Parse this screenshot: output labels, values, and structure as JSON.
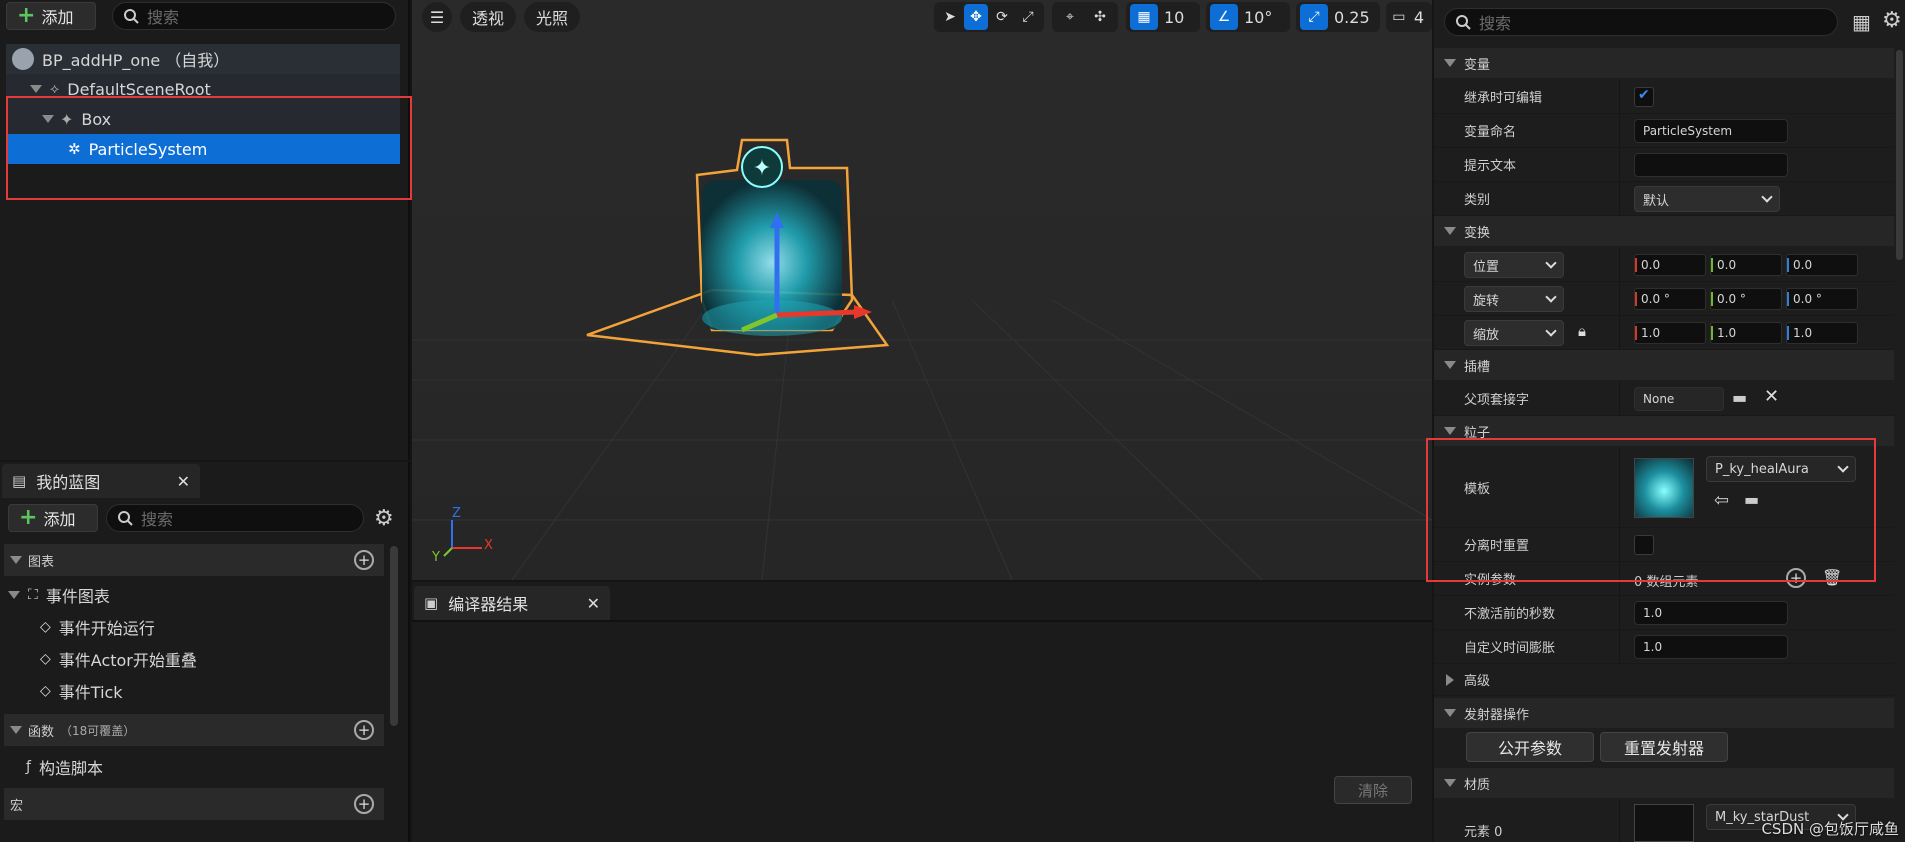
{
  "components": {
    "add_label": "添加",
    "search_placeholder": "搜索",
    "tree": [
      {
        "label": "BP_addHP_one （自我）"
      },
      {
        "label": "DefaultSceneRoot"
      },
      {
        "label": "Box"
      },
      {
        "label": "ParticleSystem"
      }
    ]
  },
  "my_blueprint": {
    "tab_label": "我的蓝图",
    "add_label": "添加",
    "search_placeholder": "搜索",
    "graphs_header": "图表",
    "event_graph": "事件图表",
    "events": [
      "事件开始运行",
      "事件Actor开始重叠",
      "事件Tick"
    ],
    "functions_header": "函数",
    "functions_note": "（18可覆盖）",
    "construction_script": "构造脚本",
    "macros_header": "宏"
  },
  "viewport": {
    "view_mode": "透视",
    "lighting": "光照",
    "grid_snap": "10",
    "rot_snap": "10°",
    "scale_snap": "0.25",
    "cam_speed": "4",
    "axis_x": "X",
    "axis_y": "Y",
    "axis_z": "Z"
  },
  "compiler": {
    "tab_label": "编译器结果",
    "clear_label": "清除"
  },
  "details": {
    "search_placeholder": "搜索",
    "sections": {
      "variable": "变量",
      "transform": "变换",
      "sockets": "插槽",
      "particles": "粒子",
      "advanced": "高级",
      "emitter_actions": "发射器操作",
      "materials": "材质"
    },
    "variable": {
      "editable_label": "继承时可编辑",
      "name_label": "变量命名",
      "name_value": "ParticleSystem",
      "tooltip_label": "提示文本",
      "tooltip_value": "",
      "category_label": "类别",
      "category_value": "默认"
    },
    "transform": {
      "location_label": "位置",
      "location": [
        "0.0",
        "0.0",
        "0.0"
      ],
      "rotation_label": "旋转",
      "rotation": [
        "0.0 °",
        "0.0 °",
        "0.0 °"
      ],
      "scale_label": "缩放",
      "scale": [
        "1.0",
        "1.0",
        "1.0"
      ]
    },
    "sockets": {
      "parent_socket_label": "父项套接字",
      "parent_socket_value": "None"
    },
    "particles": {
      "template_label": "模板",
      "template_value": "P_ky_healAura",
      "reset_on_detach_label": "分离时重置",
      "instance_params_label": "实例参数",
      "instance_params_value": "0 数组元素",
      "secs_before_inactive_label": "不激活前的秒数",
      "secs_before_inactive_value": "1.0",
      "custom_time_dilation_label": "自定义时间膨胀",
      "custom_time_dilation_value": "1.0"
    },
    "emitter_actions": {
      "expose_params": "公开参数",
      "reset_emitter": "重置发射器"
    },
    "materials": {
      "element_label": "元素 0",
      "element_value": "M_ky_starDust"
    }
  },
  "watermark": "CSDN @包饭厅咸鱼",
  "colors": {
    "accent": "#0d6ed6",
    "highlight_box": "#e33b3b",
    "selection_outline": "#f2a33a"
  }
}
